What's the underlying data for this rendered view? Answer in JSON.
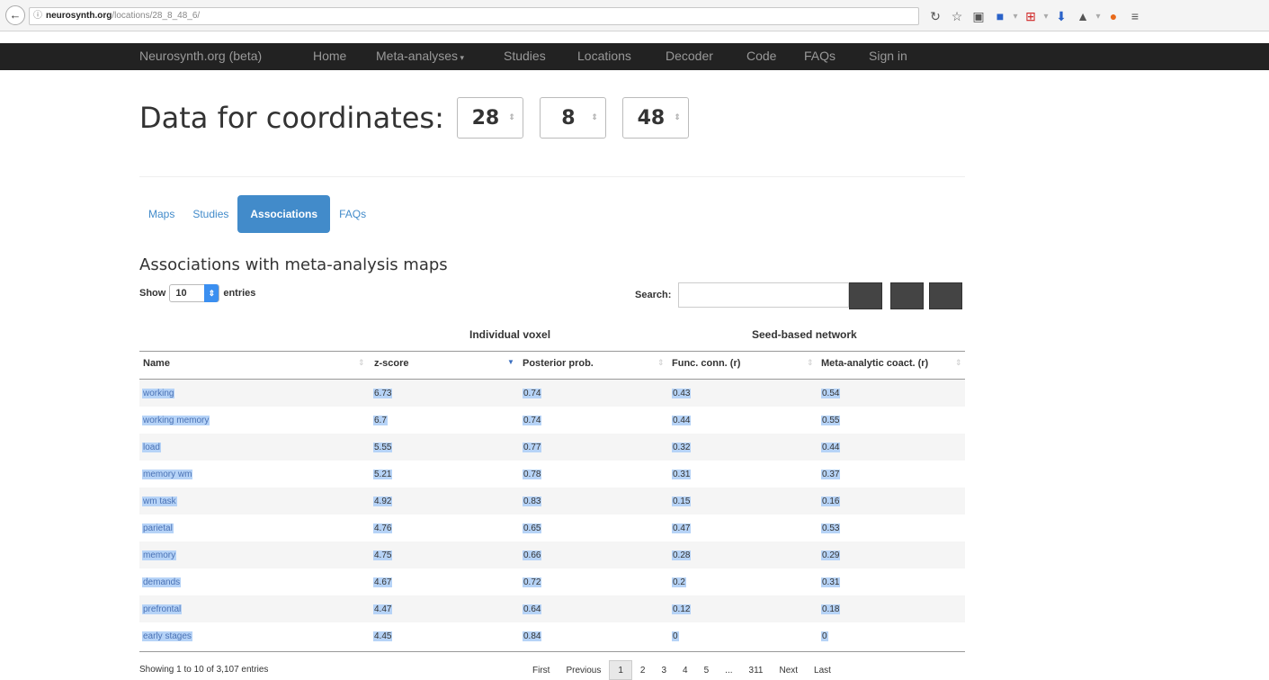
{
  "browser": {
    "back": "←",
    "info_icon": "ⓘ",
    "url_host": "neurosynth.org",
    "url_path": "/locations/28_8_48_6/",
    "toolbar_icons": [
      "refresh-icon",
      "star-icon",
      "clipboard-icon",
      "save-icon",
      "addon-icon",
      "download-icon",
      "extension-icon",
      "firefox-icon",
      "menu-icon"
    ]
  },
  "navbar": {
    "brand": "Neurosynth.org (beta)",
    "items": [
      "Home",
      "Meta-analyses",
      "Studies",
      "Locations",
      "Decoder",
      "Code",
      "FAQs",
      "Sign in"
    ]
  },
  "page": {
    "title": "Data for coordinates:",
    "coords": [
      "28",
      "8",
      "48"
    ]
  },
  "tabs": [
    "Maps",
    "Studies",
    "Associations",
    "FAQs"
  ],
  "active_tab": "Associations",
  "section_title": "Associations with meta-analysis maps",
  "controls": {
    "show_label": "Show",
    "entries_value": "10",
    "entries_label": "entries",
    "search_label": "Search:",
    "search_value": ""
  },
  "table": {
    "group_headers": [
      "Individual voxel",
      "Seed-based network"
    ],
    "columns": [
      "Name",
      "z-score",
      "Posterior prob.",
      "Func. conn. (r)",
      "Meta-analytic coact. (r)"
    ],
    "sorted_column": "z-score",
    "rows": [
      [
        "working",
        "6.73",
        "0.74",
        "0.43",
        "0.54"
      ],
      [
        "working memory",
        "6.7",
        "0.74",
        "0.44",
        "0.55"
      ],
      [
        "load",
        "5.55",
        "0.77",
        "0.32",
        "0.44"
      ],
      [
        "memory wm",
        "5.21",
        "0.78",
        "0.31",
        "0.37"
      ],
      [
        "wm task",
        "4.92",
        "0.83",
        "0.15",
        "0.16"
      ],
      [
        "parietal",
        "4.76",
        "0.65",
        "0.47",
        "0.53"
      ],
      [
        "memory",
        "4.75",
        "0.66",
        "0.28",
        "0.29"
      ],
      [
        "demands",
        "4.67",
        "0.72",
        "0.2",
        "0.31"
      ],
      [
        "prefrontal",
        "4.47",
        "0.64",
        "0.12",
        "0.18"
      ],
      [
        "early stages",
        "4.45",
        "0.84",
        "0",
        "0"
      ]
    ]
  },
  "footer": {
    "info": "Showing 1 to 10 of 3,107 entries",
    "pager": {
      "first": "First",
      "previous": "Previous",
      "pages": [
        "1",
        "2",
        "3",
        "4",
        "5"
      ],
      "ellipsis": "...",
      "last_page": "311",
      "next": "Next",
      "last": "Last",
      "current": "1"
    }
  },
  "colors": {
    "navbar_bg": "#222222",
    "accent": "#428bca",
    "selection": "#b6d3f7"
  }
}
